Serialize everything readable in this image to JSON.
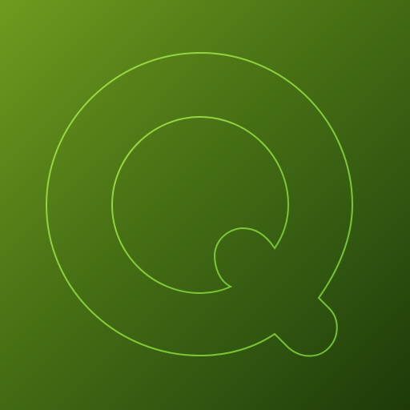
{
  "app_icon": {
    "name": "q-letter-logo-icon",
    "background": {
      "gradient_start": "#6f9b1f",
      "gradient_mid": "#4a7415",
      "gradient_end": "#1d3a08"
    },
    "outline_color": "#8fd13a",
    "outline_color_light": "#a6e04a"
  }
}
